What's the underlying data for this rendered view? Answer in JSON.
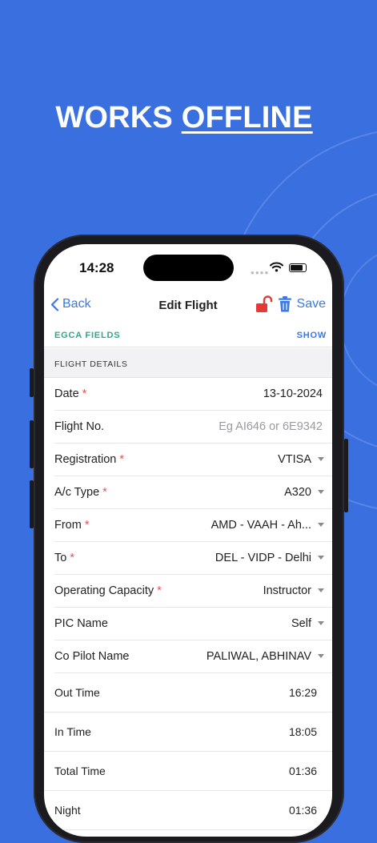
{
  "headline": {
    "part1": "WORKS ",
    "part2": "OFFLINE"
  },
  "status_bar": {
    "time": "14:28"
  },
  "navbar": {
    "back_label": "Back",
    "title": "Edit Flight",
    "save_label": "Save"
  },
  "egca": {
    "label": "EGCA FIELDS",
    "action": "SHOW"
  },
  "section_header": "FLIGHT DETAILS",
  "required_mark": "*",
  "fields": [
    {
      "label": "Date",
      "required": true,
      "value": "13-10-2024",
      "dropdown": false,
      "placeholder": false
    },
    {
      "label": "Flight No.",
      "required": false,
      "value": "Eg AI646 or 6E9342",
      "dropdown": false,
      "placeholder": true
    },
    {
      "label": "Registration",
      "required": true,
      "value": "VTISA",
      "dropdown": true,
      "placeholder": false
    },
    {
      "label": "A/c Type",
      "required": true,
      "value": "A320",
      "dropdown": true,
      "placeholder": false
    },
    {
      "label": "From",
      "required": true,
      "value": "AMD - VAAH - Ah...",
      "dropdown": true,
      "placeholder": false
    },
    {
      "label": "To",
      "required": true,
      "value": "DEL - VIDP - Delhi",
      "dropdown": true,
      "placeholder": false
    },
    {
      "label": "Operating Capacity",
      "required": true,
      "value": "Instructor",
      "dropdown": true,
      "placeholder": false
    },
    {
      "label": "PIC Name",
      "required": false,
      "value": "Self",
      "dropdown": true,
      "placeholder": false
    },
    {
      "label": "Co Pilot Name",
      "required": false,
      "value": "PALIWAL, ABHINAV",
      "dropdown": true,
      "placeholder": false
    }
  ],
  "times": [
    {
      "label": "Out Time",
      "value": "16:29"
    },
    {
      "label": "In Time",
      "value": "18:05"
    },
    {
      "label": "Total Time",
      "value": "01:36"
    },
    {
      "label": "Night",
      "value": "01:36"
    }
  ],
  "colors": {
    "background": "#3a6fe0",
    "accent": "#3a78e6",
    "egca": "#2fa88c",
    "required": "#e25353",
    "lock": "#e53935"
  }
}
